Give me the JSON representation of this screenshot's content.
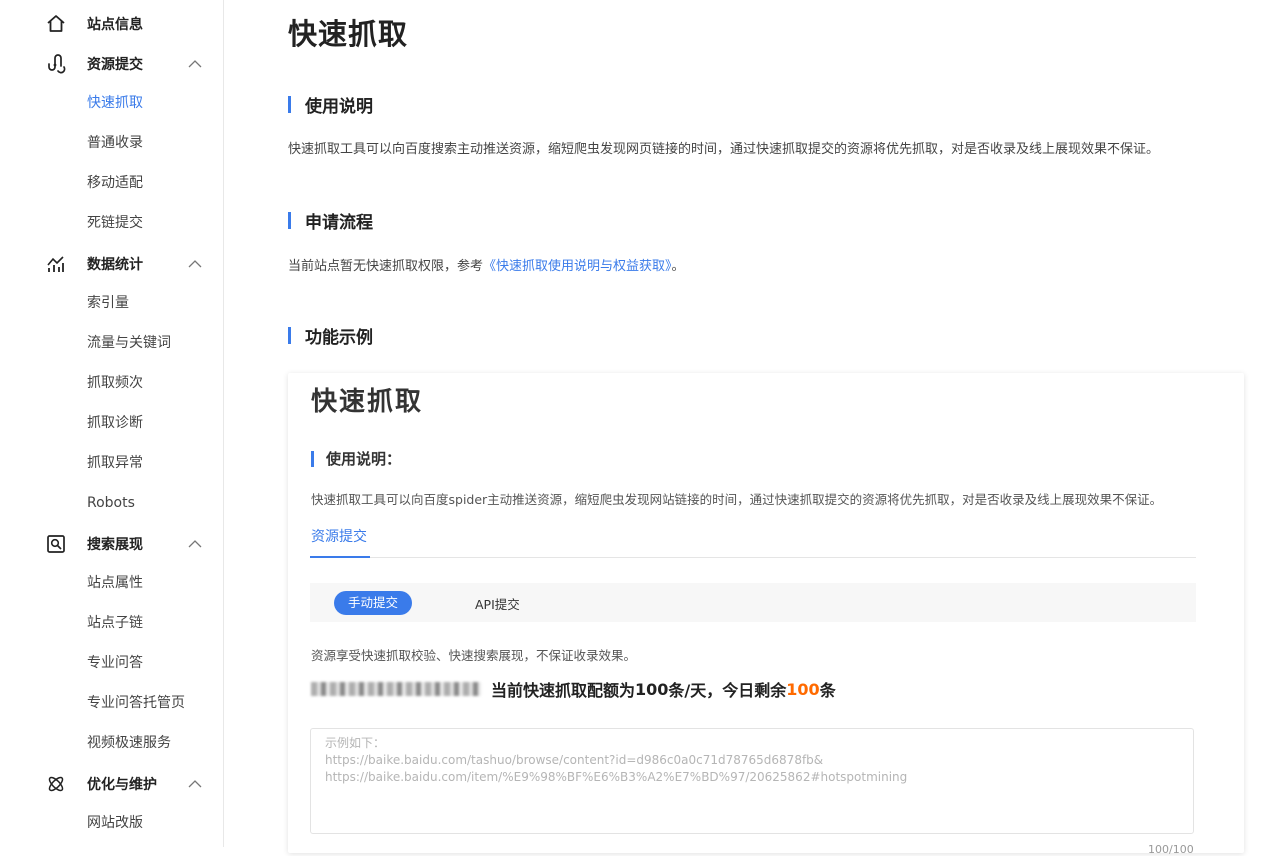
{
  "sidebar": {
    "groups": [
      {
        "label": "站点信息",
        "icon": "home-icon"
      },
      {
        "label": "资源提交",
        "icon": "link-submit-icon"
      },
      {
        "label": "数据统计",
        "icon": "chart-icon"
      },
      {
        "label": "搜索展现",
        "icon": "search-display-icon"
      },
      {
        "label": "优化与维护",
        "icon": "atom-icon"
      }
    ],
    "items": [
      "快速抓取",
      "普通收录",
      "移动适配",
      "死链提交",
      "索引量",
      "流量与关键词",
      "抓取频次",
      "抓取诊断",
      "抓取异常",
      "Robots",
      "站点属性",
      "站点子链",
      "专业问答",
      "专业问答托管页",
      "视频极速服务",
      "网站改版"
    ],
    "active_item": "快速抓取"
  },
  "main": {
    "title": "快速抓取",
    "sections": [
      {
        "heading": "使用说明",
        "text": "快速抓取工具可以向百度搜索主动推送资源，缩短爬虫发现网页链接的时间，通过快速抓取提交的资源将优先抓取，对是否收录及线上展现效果不保证。"
      },
      {
        "heading": "申请流程",
        "text_before": "当前站点暂无快速抓取权限，参考",
        "link": "《快速抓取使用说明与权益获取》",
        "text_after": "。"
      },
      {
        "heading": "功能示例"
      }
    ]
  },
  "example": {
    "title": "快速抓取",
    "section_heading": "使用说明：",
    "desc": "快速抓取工具可以向百度spider主动推送资源，缩短爬虫发现网站链接的时间，通过快速抓取提交的资源将优先抓取，对是否收录及线上展现效果不保证。",
    "tab": "资源提交",
    "segments": [
      "手动提交",
      "API提交"
    ],
    "note": "资源享受快速抓取校验、快速搜索展现，不保证收录效果。",
    "quota": {
      "prefix": "当前快速抓取配额为",
      "quota": "100",
      "mid": "条/天，今日剩余",
      "remaining": "100",
      "suffix": "条"
    },
    "textarea_placeholder": "示例如下：\nhttps://baike.baidu.com/tashuo/browse/content?id=d986c0a0c71d78765d6878fb&\nhttps://baike.baidu.com/item/%E9%98%BF%E6%B3%A2%E7%BD%97/20625862#hotspotmining",
    "counter": "100/100"
  },
  "colors": {
    "accent": "#3a7bea",
    "highlight": "#ff6a00"
  }
}
